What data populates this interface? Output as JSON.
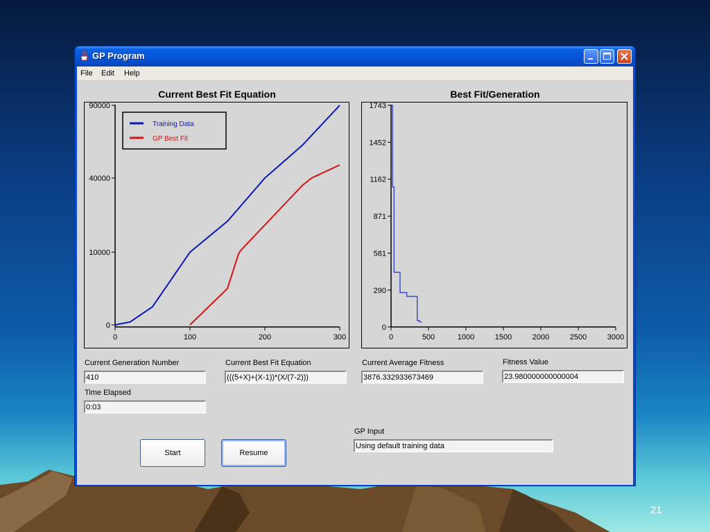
{
  "window": {
    "title": "GP Program"
  },
  "menu": [
    "File",
    "Edit",
    "Help"
  ],
  "left_chart": {
    "title": "Current Best Fit Equation",
    "y_ticks": [
      "90000",
      "40000",
      "10000",
      "0"
    ],
    "x_ticks": [
      "0",
      "100",
      "200",
      "300"
    ],
    "legend": [
      {
        "label": "Training Data",
        "color": "#0b17b8"
      },
      {
        "label": "GP Best Fit",
        "color": "#d41414"
      }
    ]
  },
  "right_chart": {
    "title": "Best Fit/Generation",
    "y_ticks": [
      "1743",
      "1452",
      "1162",
      "871",
      "581",
      "290",
      "0"
    ],
    "x_ticks": [
      "0",
      "500",
      "1000",
      "1500",
      "2000",
      "2500",
      "3000"
    ],
    "line_color": "#1d2fc8"
  },
  "chart_data": [
    {
      "type": "line",
      "title": "Current Best Fit Equation",
      "xlabel": "",
      "ylabel": "",
      "xlim": [
        0,
        300
      ],
      "y_tick_labels": [
        "0",
        "10000",
        "40000",
        "90000"
      ],
      "legend_position": "top-left",
      "grid": false,
      "series": [
        {
          "name": "Training Data",
          "x": [
            0,
            20,
            50,
            100,
            150,
            200,
            250,
            300
          ],
          "y": [
            0,
            400,
            2500,
            10000,
            22500,
            40000,
            62500,
            90000
          ]
        },
        {
          "name": "GP Best Fit",
          "x": [
            100,
            150,
            200,
            250,
            300
          ],
          "y": [
            0,
            5000,
            21000,
            37000,
            49000
          ]
        }
      ]
    },
    {
      "type": "line",
      "title": "Best Fit/Generation",
      "xlabel": "",
      "ylabel": "",
      "xlim": [
        0,
        3000
      ],
      "ylim": [
        0,
        1743
      ],
      "grid": false,
      "series": [
        {
          "name": "",
          "x": [
            0,
            20,
            40,
            120,
            210,
            350,
            380,
            410
          ],
          "y": [
            1743,
            1100,
            430,
            270,
            240,
            50,
            40,
            40
          ]
        }
      ]
    }
  ],
  "fields": {
    "generation_label": "Current Generation Number",
    "generation_value": "410",
    "equation_label": "Current Best Fit Equation",
    "equation_value": "(((5+X)+(X-1))*(X/(7-2)))",
    "avg_fitness_label": "Current Average Fitness",
    "avg_fitness_value": "3876.332933673469",
    "fitness_label": "Fitness Value",
    "fitness_value": "23.980000000000004",
    "time_label": "Time Elapsed",
    "time_value": "0:03",
    "gp_input_label": "GP Input",
    "gp_input_value": "Using default training data"
  },
  "buttons": {
    "start": "Start",
    "resume": "Resume"
  },
  "slide_number": "21"
}
